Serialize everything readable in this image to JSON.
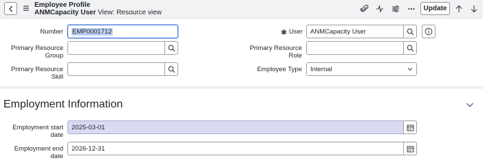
{
  "header": {
    "title": "Employee Profile",
    "record_name": "ANMCapacity User",
    "view_label": "View: Resource view",
    "update_label": "Update"
  },
  "icons": {
    "back": "chevron-left-icon",
    "menu": "hamburger-icon",
    "attachment": "paperclip-icon",
    "activity": "activity-icon",
    "settings": "sliders-icon",
    "more": "more-icon",
    "up": "arrow-up-icon",
    "down": "arrow-down-icon"
  },
  "form": {
    "number": {
      "label": "Number",
      "value": "EMP0001712"
    },
    "user": {
      "label": "User",
      "value": "ANMCapacity User",
      "required_mark": "✱"
    },
    "primary_resource_group": {
      "label_1": "Primary Resource",
      "label_2": "Group",
      "value": ""
    },
    "primary_resource_role": {
      "label_1": "Primary Resource",
      "label_2": "Role",
      "value": ""
    },
    "primary_resource_skill": {
      "label_1": "Primary Resource",
      "label_2": "Skill",
      "value": ""
    },
    "employee_type": {
      "label": "Employee Type",
      "value": "Internal"
    }
  },
  "section": {
    "title": "Employment Information",
    "employment_start": {
      "label_1": "Employment start",
      "label_2": "date",
      "value": "2025-03-01"
    },
    "employment_end": {
      "label_1": "Employment end",
      "label_2": "date",
      "value": "2026-12-31"
    }
  },
  "colors": {
    "accent": "#2e6bd8",
    "readonly_bg": "#dadbf2",
    "header_bg": "#f1f2f3"
  }
}
